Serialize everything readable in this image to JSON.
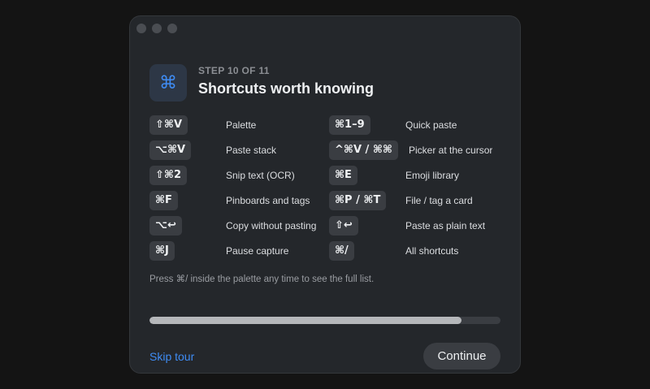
{
  "dialog": {
    "icon": "command-icon",
    "icon_glyph": "⌘",
    "step_label": "STEP 10 OF 11",
    "title": "Shortcuts worth knowing",
    "accent_color": "#3f8cf4"
  },
  "shortcuts_left": [
    {
      "keys": "⇧⌘V",
      "action": "Palette"
    },
    {
      "keys": "⌥⌘V",
      "action": "Paste stack"
    },
    {
      "keys": "⇧⌘2",
      "action": "Snip text (OCR)"
    },
    {
      "keys": "⌘F",
      "action": "Pinboards and tags"
    },
    {
      "keys": "⌥↩",
      "action": "Copy without pasting"
    },
    {
      "keys": "⌘J",
      "action": "Pause capture"
    }
  ],
  "shortcuts_right": [
    {
      "keys": "⌘1–9",
      "action": "Quick paste"
    },
    {
      "keys": "^⌘V / ⌘⌘",
      "action": "Picker at the cursor"
    },
    {
      "keys": "⌘E",
      "action": "Emoji library"
    },
    {
      "keys": "⌘P / ⌘T",
      "action": "File / tag a card"
    },
    {
      "keys": "⇧↩",
      "action": "Paste as plain text"
    },
    {
      "keys": "⌘/",
      "action": "All shortcuts"
    }
  ],
  "hint": "Press ⌘/ inside the palette any time to see the full list.",
  "progress": {
    "fraction": 0.89
  },
  "footer": {
    "skip_label": "Skip tour",
    "continue_label": "Continue"
  }
}
